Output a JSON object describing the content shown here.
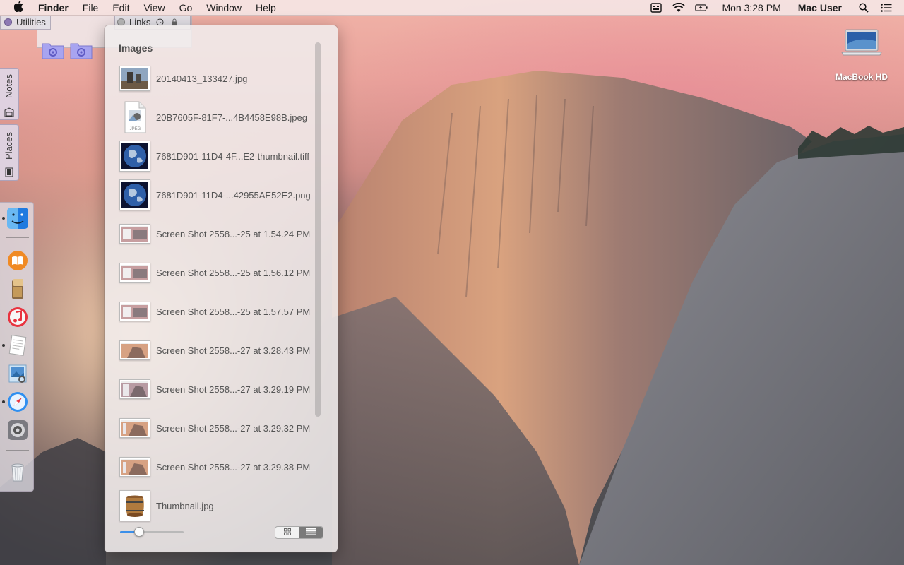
{
  "menubar": {
    "app_name": "Finder",
    "menus": [
      "File",
      "Edit",
      "View",
      "Go",
      "Window",
      "Help"
    ],
    "clock": "Mon 3:28 PM",
    "user": "Mac User"
  },
  "desktop": {
    "drive_label": "MacBook HD"
  },
  "drawers": {
    "utilities_label": "Utilities",
    "links_label": "Links",
    "notes_label": "Notes",
    "places_label": "Places"
  },
  "stack": {
    "title": "Images",
    "items": [
      {
        "name": "20140413_133427.jpg",
        "icon": "photo-thumbnail"
      },
      {
        "name": "20B7605F-81F7-...4B4458E98B.jpeg",
        "icon": "jpeg-document-icon"
      },
      {
        "name": "7681D901-11D4-4F...E2-thumbnail.tiff",
        "icon": "earth-thumbnail"
      },
      {
        "name": "7681D901-11D4-...42955AE52E2.png",
        "icon": "earth-thumbnail"
      },
      {
        "name": "Screen Shot 2558...-25 at 1.54.24 PM",
        "icon": "screenshot-thumbnail"
      },
      {
        "name": "Screen Shot 2558...-25 at 1.56.12 PM",
        "icon": "screenshot-thumbnail"
      },
      {
        "name": "Screen Shot 2558...-25 at 1.57.57 PM",
        "icon": "screenshot-thumbnail"
      },
      {
        "name": "Screen Shot 2558...-27 at 3.28.43 PM",
        "icon": "screenshot-thumbnail"
      },
      {
        "name": "Screen Shot 2558...-27 at 3.29.19 PM",
        "icon": "screenshot-thumbnail"
      },
      {
        "name": "Screen Shot 2558...-27 at 3.29.32 PM",
        "icon": "screenshot-thumbnail"
      },
      {
        "name": "Screen Shot 2558...-27 at 3.29.38 PM",
        "icon": "screenshot-thumbnail"
      },
      {
        "name": "Thumbnail.jpg",
        "icon": "barrel-thumbnail"
      }
    ],
    "icon_size_fraction": 0.3,
    "view_mode": "list"
  },
  "dock": {
    "items": [
      "finder-icon",
      "ibooks-icon",
      "notes-stack-icon",
      "itunes-icon",
      "textedit-icon",
      "preview-icon",
      "safari-icon",
      "system-preferences-icon",
      "trash-icon"
    ]
  },
  "colors": {
    "accent": "#3b8fe9",
    "drawer_tab": "#8e79b4"
  }
}
